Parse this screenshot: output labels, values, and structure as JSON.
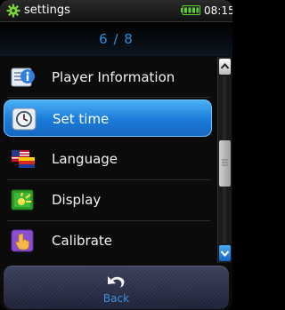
{
  "statusbar": {
    "title": "settings",
    "time": "08:15",
    "icon": "gear-icon",
    "battery": "battery-full-icon"
  },
  "pager": {
    "indicator": "6 / 8"
  },
  "list": {
    "items": [
      {
        "label": "Player Information",
        "icon": "info-icon",
        "selected": false
      },
      {
        "label": "Set time",
        "icon": "clock-icon",
        "selected": true
      },
      {
        "label": "Language",
        "icon": "flags-icon",
        "selected": false
      },
      {
        "label": "Display",
        "icon": "display-icon",
        "selected": false
      },
      {
        "label": "Calibrate",
        "icon": "touch-hand-icon",
        "selected": false
      }
    ]
  },
  "footer": {
    "back_label": "Back",
    "back_icon": "undo-arrow-icon"
  },
  "colors": {
    "accent": "#1a7ad9",
    "pager_text": "#2a8fe0",
    "back_text": "#3b8ede"
  }
}
